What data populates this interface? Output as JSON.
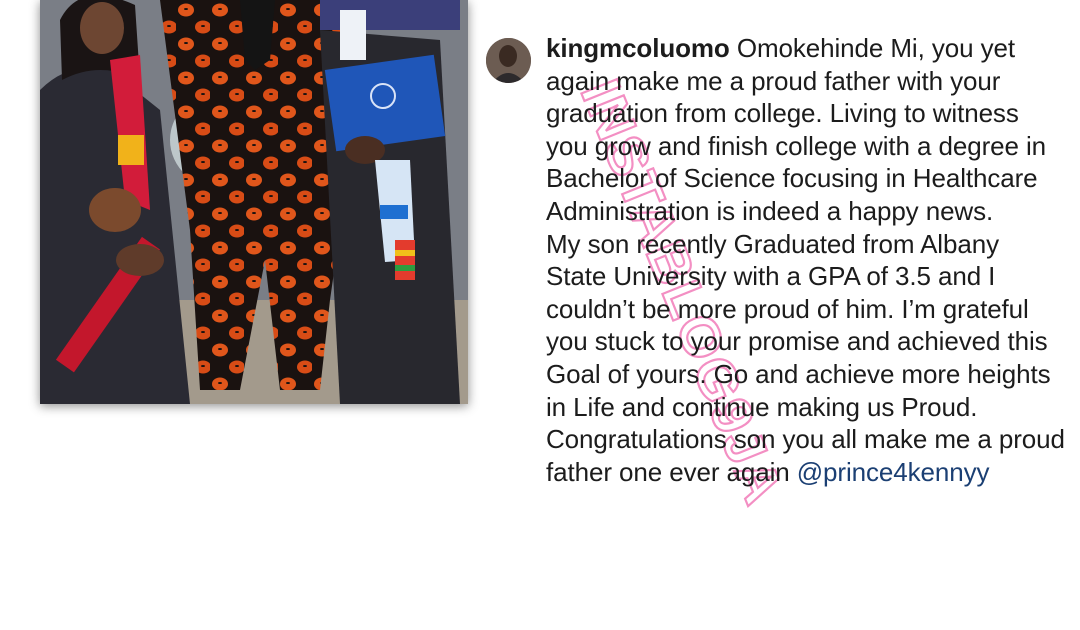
{
  "post": {
    "username": "kingmcoluomo",
    "caption_intro": " Omokehinde Mi, you yet again make me  a proud father with your graduation from college. Living to witness you grow and finish college with a degree in Bachelor of Science focusing in Healthcare Administration is indeed a happy news.",
    "caption_body": "My son recently Graduated from Albany State University with a GPA of 3.5 and I couldn’t be more proud of him. I’m grateful you stuck to your promise and achieved this Goal of yours. Go and achieve more heights in Life and continue making us Proud. Congratulations son you all make me a proud father one ever again ",
    "mention": "@prince4kennyy"
  },
  "photo": {
    "subject": "graduation-photo"
  },
  "watermark": {
    "text": "INSTABLOG9JA",
    "color": "#f06ab0"
  },
  "colors": {
    "mention": "#1b3f73",
    "text": "#1c1c1c"
  }
}
